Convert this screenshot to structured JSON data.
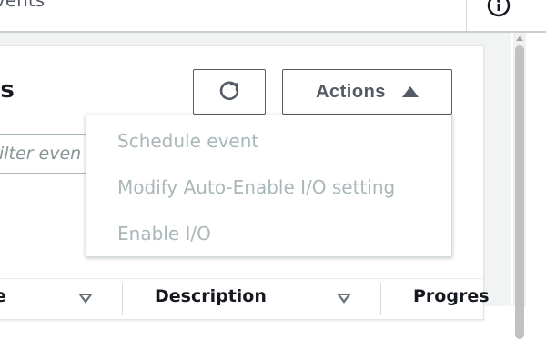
{
  "search": {
    "text": "vents"
  },
  "card": {
    "title": "ts"
  },
  "filter": {
    "placeholder": "ilter even"
  },
  "toolbar": {
    "refresh_icon": "refresh-icon",
    "actions_label": "Actions",
    "actions_caret": "caret-up-icon"
  },
  "actions_menu": {
    "items": [
      {
        "label": "Schedule event"
      },
      {
        "label": "Modify Auto-Enable I/O setting"
      },
      {
        "label": "Enable I/O"
      }
    ]
  },
  "table": {
    "columns": [
      {
        "label": "e"
      },
      {
        "label": "Description"
      },
      {
        "label": "Progres"
      }
    ]
  },
  "colors": {
    "border": "#545b64",
    "disabled_text": "#aab7b8",
    "background": "#f2f3f3"
  }
}
